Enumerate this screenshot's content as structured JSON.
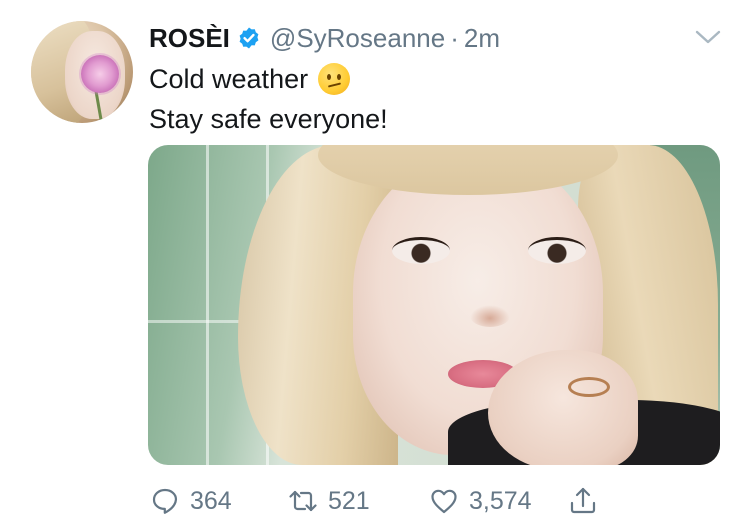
{
  "user": {
    "display_name": "ROSÈI",
    "handle": "@SyRoseanne",
    "separator": "·",
    "time": "2m",
    "verified": true,
    "avatar": "profile-photo"
  },
  "tweet": {
    "lines": [
      "Cold weather",
      "Stay safe everyone!"
    ],
    "emoji": "confused-face-emoji",
    "media": "selfie-photo"
  },
  "actions": {
    "reply_count": "364",
    "retweet_count": "521",
    "like_count": "3,574",
    "icons": [
      "reply-icon",
      "retweet-icon",
      "like-icon",
      "share-icon"
    ]
  },
  "colors": {
    "text": "#14171a",
    "secondary": "#657786",
    "verified_blue": "#1da1f2"
  }
}
